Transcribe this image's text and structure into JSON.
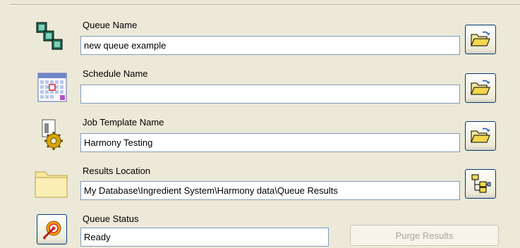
{
  "fields": {
    "queue_name": {
      "label": "Queue Name",
      "value": "new queue example",
      "icon": "queue-icon"
    },
    "schedule_name": {
      "label": "Schedule Name",
      "value": "",
      "icon": "calendar-icon"
    },
    "job_template_name": {
      "label": "Job Template Name",
      "value": "Harmony Testing",
      "icon": "job-template-gear-icon"
    },
    "results_location": {
      "label": "Results Location",
      "value": "My Database\\Ingredient System\\Harmony data\\Queue Results",
      "icon": "folder-icon"
    },
    "queue_status": {
      "label": "Queue Status",
      "value": "Ready",
      "icon": "target-icon"
    }
  },
  "buttons": {
    "purge_results": {
      "label": "Purge Results",
      "enabled": false
    }
  },
  "colors": {
    "background": "#ece9d8",
    "input_border": "#7f9db9",
    "button_border": "#003c74",
    "disabled_text": "#aca899",
    "folder_yellow": "#f8e79a"
  }
}
